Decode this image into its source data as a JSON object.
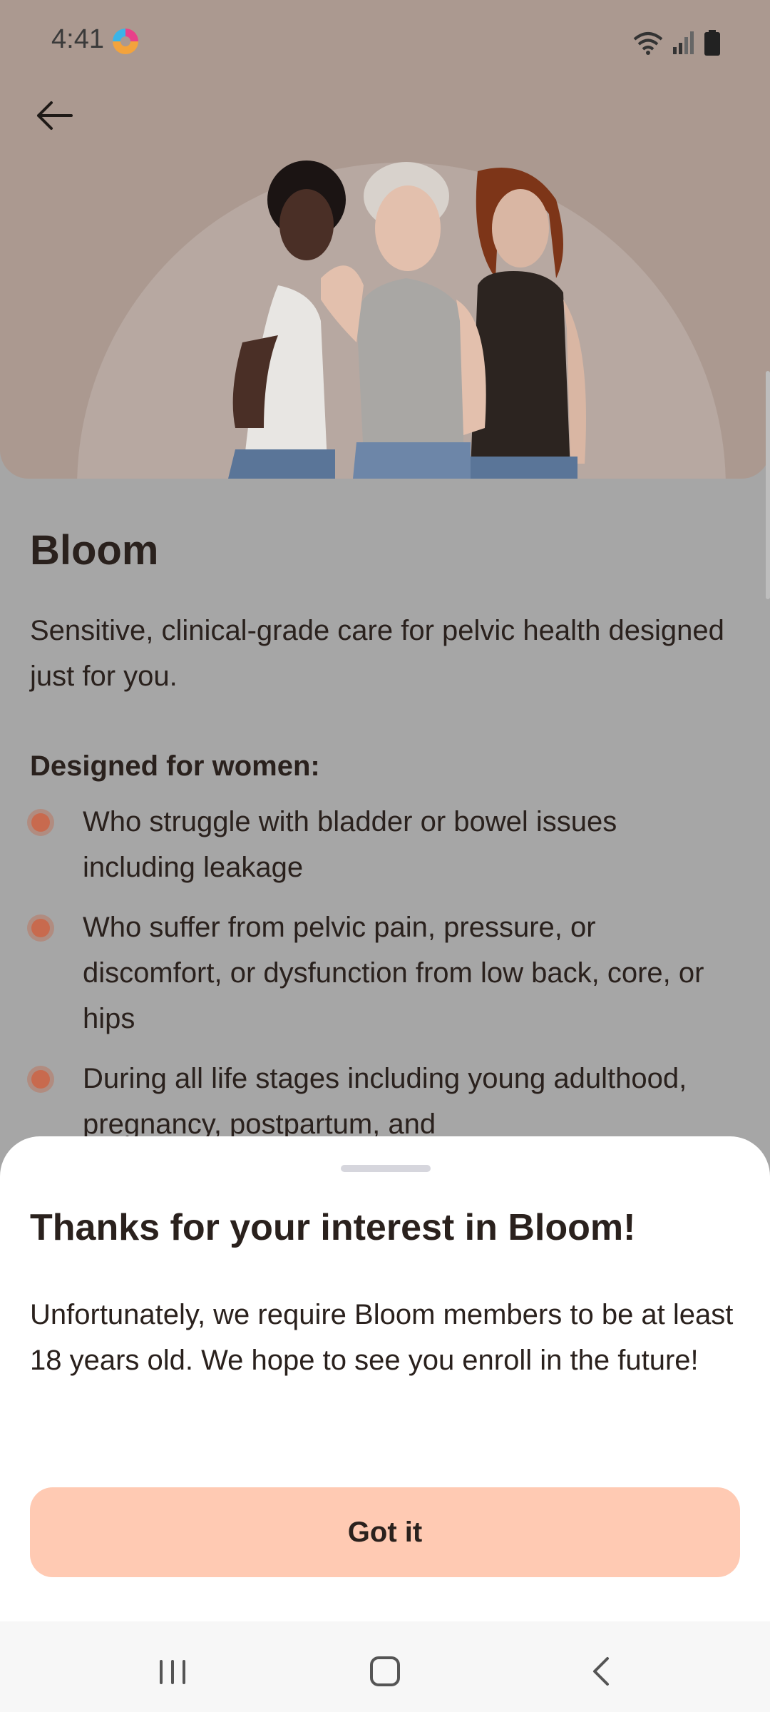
{
  "status_bar": {
    "time": "4:41",
    "icons": [
      "app-notification-icon",
      "wifi-icon",
      "signal-icon",
      "battery-icon"
    ]
  },
  "header": {
    "back_icon": "arrow-left-icon"
  },
  "product": {
    "title": "Bloom",
    "description": "Sensitive, clinical-grade care for pelvic health designed just for you.",
    "designed_for_heading": "Designed for women:",
    "bullets": [
      "Who struggle with bladder or bowel issues including leakage",
      "Who suffer from pelvic pain, pressure, or discomfort, or dysfunction from low back, core, or hips",
      "During all life stages including young adulthood, pregnancy, postpartum, and"
    ]
  },
  "sheet": {
    "title": "Thanks for your interest in Bloom!",
    "body": "Unfortunately, we require Bloom members to be at least 18 years old. We hope to see you enroll in the future!",
    "button_label": "Got it"
  },
  "nav_bar": {
    "icons": [
      "recents-icon",
      "home-icon",
      "back-icon"
    ]
  },
  "colors": {
    "hero_bg": "#ab9990",
    "accent_button": "#ffcab3",
    "bullet_dot": "#c86a4e",
    "scrim": "#a6a6a6"
  }
}
